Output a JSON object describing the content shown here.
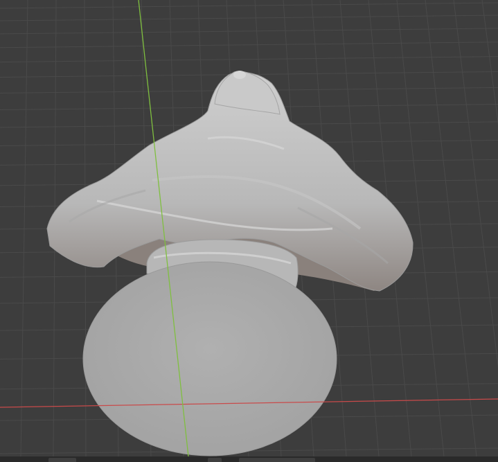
{
  "viewport": {
    "background_color": "#3d3d3d",
    "grid_color": "#4a4a4a",
    "x_axis_color": "#c94a4a",
    "y_axis_color": "#7fbf3f",
    "model_color": "#bdbdbd",
    "model_shadow_color": "#8d8d8d",
    "base_color": "#a9a9a9"
  }
}
